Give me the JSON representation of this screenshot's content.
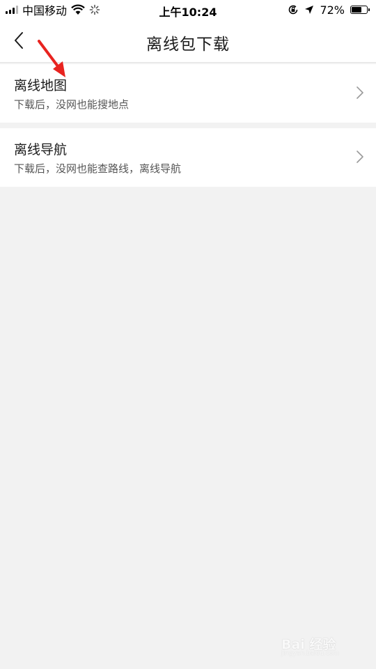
{
  "status_bar": {
    "carrier": "中国移动",
    "time": "上午10:24",
    "battery_percent": "72%",
    "battery_level": 0.72,
    "icons": [
      "signal-icon",
      "wifi-icon",
      "loading-icon",
      "rotation-lock-icon",
      "location-icon",
      "battery-icon"
    ]
  },
  "nav": {
    "title": "离线包下载",
    "back_icon": "back-chevron-icon"
  },
  "items": [
    {
      "title": "离线地图",
      "desc": "下载后，没网也能搜地点",
      "icon": "chevron-right-icon"
    },
    {
      "title": "离线导航",
      "desc": "下载后，没网也能查路线，离线导航",
      "icon": "chevron-right-icon"
    }
  ],
  "annotation": {
    "arrow_color": "#e8231f"
  },
  "watermark": {
    "brand": "Bai 经验",
    "url": "jingyan.baidu.com"
  },
  "colors": {
    "background": "#f2f2f2",
    "card": "#ffffff",
    "primary_text": "#1a1a1a",
    "secondary_text": "#555555"
  }
}
